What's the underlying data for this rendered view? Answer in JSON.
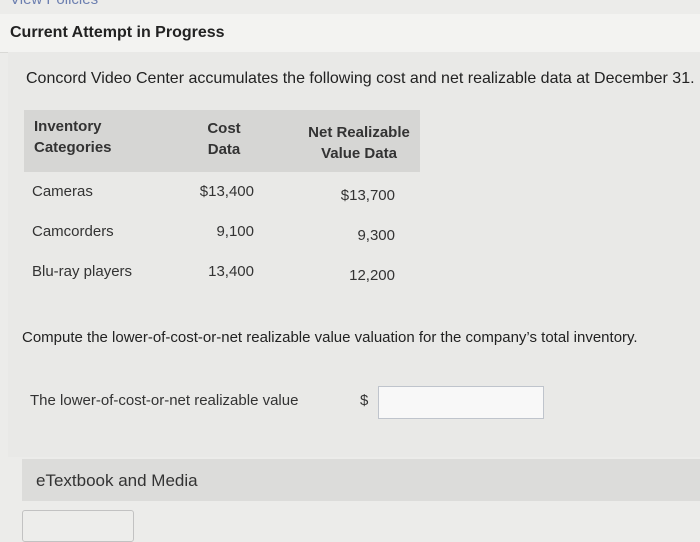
{
  "top_link": "View Policies",
  "attempt": {
    "title": "Current Attempt in Progress"
  },
  "problem": {
    "intro": "Concord Video Center accumulates the following cost and net realizable data at December 31.",
    "table": {
      "headers": {
        "category": [
          "Inventory",
          "Categories"
        ],
        "cost": [
          "Cost",
          "Data"
        ],
        "nrv": [
          "Net Realizable",
          "Value Data"
        ]
      },
      "rows": [
        {
          "category": "Cameras",
          "cost": "$13,400",
          "nrv": "$13,700"
        },
        {
          "category": "Camcorders",
          "cost": "9,100",
          "nrv": "9,300"
        },
        {
          "category": "Blu-ray players",
          "cost": "13,400",
          "nrv": "12,200"
        }
      ]
    },
    "question": "Compute the lower-of-cost-or-net realizable value valuation for the company’s total inventory.",
    "answer": {
      "label": "The lower-of-cost-or-net realizable value",
      "currency": "$",
      "value": ""
    }
  },
  "etextbook": {
    "label": "eTextbook and Media"
  }
}
